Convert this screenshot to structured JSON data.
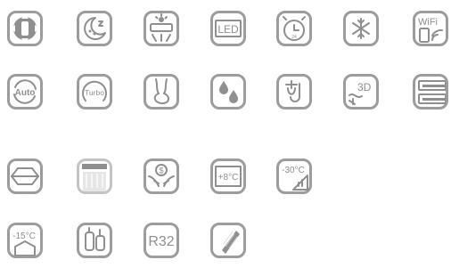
{
  "icons": [
    {
      "name": "swing-icon"
    },
    {
      "name": "sleep-mode-icon"
    },
    {
      "name": "air-conditioner-icon"
    },
    {
      "name": "led-display-icon",
      "text": "LED"
    },
    {
      "name": "timer-clock-icon",
      "text": "24"
    },
    {
      "name": "self-cleaning-icon"
    },
    {
      "name": "wifi-control-icon",
      "text": "WiFi"
    },
    {
      "name": "auto-mode-icon",
      "text": "Auto"
    },
    {
      "name": "turbo-mode-icon",
      "text": "Turbo"
    },
    {
      "name": "comfort-airflow-icon"
    },
    {
      "name": "dehumidify-icon"
    },
    {
      "name": "quiet-icon"
    },
    {
      "name": "3d-airflow-icon",
      "text": "3D"
    },
    {
      "name": "dual-flap-icon"
    },
    {
      "name": "hexagon-filter-icon"
    },
    {
      "name": "air-curtain-icon"
    },
    {
      "name": "energy-saving-icon"
    },
    {
      "name": "heating-temperature-icon",
      "text": "+8°C"
    },
    {
      "name": "low-temperature-cooling-icon",
      "text": "-30°C"
    },
    {
      "name": "low-temperature-heating-icon",
      "text": "-15°C"
    },
    {
      "name": "compressor-icon"
    },
    {
      "name": "r32-refrigerant-icon",
      "text": "R32"
    },
    {
      "name": "gold-fin-icon"
    }
  ]
}
